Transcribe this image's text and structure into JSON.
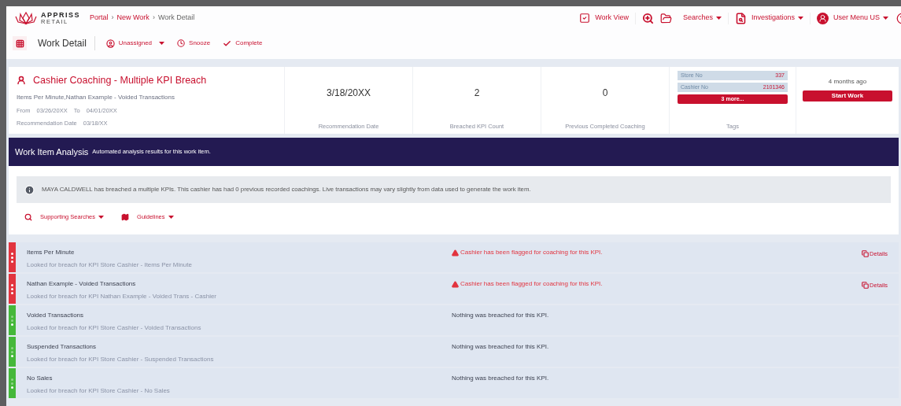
{
  "header": {
    "logo": {
      "name": "APPRISS",
      "sub": "RETAIL"
    },
    "breadcrumbs": [
      {
        "label": "Portal",
        "link": true
      },
      {
        "label": "›",
        "link": false
      },
      {
        "label": "New Work",
        "link": true
      },
      {
        "label": "›",
        "link": false
      },
      {
        "label": "Work Detail",
        "link": false
      }
    ],
    "page_title": "Work Detail",
    "actions": [
      {
        "kind": "assign",
        "label": "Unassigned",
        "dropdown": true
      },
      {
        "kind": "snooze",
        "label": "Snooze",
        "dropdown": false
      },
      {
        "kind": "complete",
        "label": "Complete",
        "dropdown": false
      }
    ],
    "nav": [
      {
        "kind": "workview",
        "label": "Work View",
        "dropdown": false
      },
      {
        "kind": "searches",
        "label": "Searches",
        "dropdown": true
      },
      {
        "kind": "investigations",
        "label": "Investigations",
        "dropdown": true
      },
      {
        "kind": "user",
        "label": "User Menu US",
        "dropdown": true
      }
    ]
  },
  "work_item": {
    "title": "Cashier Coaching - Multiple KPI Breach",
    "kpis": "Items Per Minute,Nathan Example - Voided Transactions",
    "from_label": "From",
    "from": "03/26/20XX",
    "to_label": "To",
    "to": "04/01/20XX",
    "rec_label": "Recommendation Date",
    "rec_date": "03/18/XX",
    "stats": [
      {
        "value": "3/18/20XX",
        "label": "Recommendation Date"
      },
      {
        "value": "2",
        "label": "Breached KPI Count"
      },
      {
        "value": "0",
        "label": "Previous Completed Coaching"
      }
    ],
    "tags": {
      "items": [
        {
          "name": "Store No",
          "value": "337"
        },
        {
          "name": "Cashier No",
          "value": "2101346"
        }
      ],
      "more": "3 more...",
      "label": "Tags"
    },
    "age": "4 months ago",
    "start_button": "Start Work"
  },
  "analysis": {
    "title": "Work Item Analysis",
    "subtitle": "Automated analysis results for this work item.",
    "notice": "MAYA CALDWELL has breached a multiple KPIs. This cashier has had 0 previous recorded coachings. Live transactions may vary slightly from data used to generate the work item.",
    "menus": [
      {
        "kind": "search",
        "label": "Supporting Searches"
      },
      {
        "kind": "guidelines",
        "label": "Guidelines"
      }
    ]
  },
  "kpi_rows": [
    {
      "title": "Items Per Minute",
      "description": "Looked for breach for KPI Store Cashier - Items Per Minute",
      "breached": true,
      "message": "Cashier has been flagged for coaching for this KPI.",
      "details": "Details"
    },
    {
      "title": "Nathan Example - Voided Transactions",
      "description": "Looked for breach for KPI Nathan Example - Voided Trans - Cashier",
      "breached": true,
      "message": "Cashier has been flagged for coaching for this KPI.",
      "details": "Details"
    },
    {
      "title": "Voided Transactions",
      "description": "Looked for breach for KPI Store Cashier - Voided Transactions",
      "breached": false,
      "message": "Nothing was breached for this KPI."
    },
    {
      "title": "Suspended Transactions",
      "description": "Looked for breach for KPI Store Cashier - Suspended Transactions",
      "breached": false,
      "message": "Nothing was breached for this KPI."
    },
    {
      "title": "No Sales",
      "description": "Looked for breach for KPI Store Cashier - No Sales",
      "breached": false,
      "message": "Nothing was breached for this KPI."
    }
  ]
}
